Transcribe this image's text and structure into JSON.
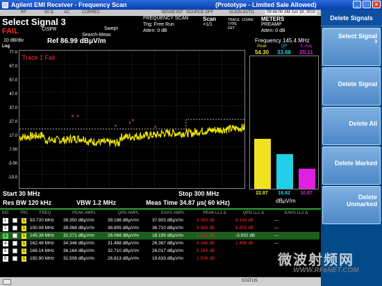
{
  "window": {
    "title": "Agilent EMI Receiver - Frequency Scan",
    "prototype": "(Prototype - Limited Sale Allowed)"
  },
  "status_row": {
    "items": [
      "RF",
      "50 Ω",
      "AC",
      "CORREC",
      "SENSE:INT",
      "SOURCE OFF",
      "ALIGN AUTO"
    ],
    "datetime": "09:46:00 AM Jun 18, 2010"
  },
  "header": {
    "measurement": "Select Signal  3",
    "fail": "FAIL",
    "cispr": "CISPR",
    "swept": "Swept",
    "search_meas": "Search-Meas",
    "scan_mode": "FREQUENCY SCAN",
    "trig": "Trig: Free Run",
    "atten_left": "Atten: 0 dB",
    "scan": "Scan",
    "scan_count": ">1/1",
    "trace_labels": [
      "TRACE",
      "TYPE",
      "DET"
    ],
    "trace_values": [
      "1",
      "2",
      "3",
      "4",
      "5",
      "6"
    ],
    "meters": "METERS",
    "preamp": "PREAMP",
    "atten_right": "Atten: 0 dB"
  },
  "graph": {
    "scale": "10 dB/div",
    "ref_level": "Ref 86.99 dBμV/m",
    "log": "Log",
    "trace_fail": "Trace 1 Fail",
    "y_ticks": [
      "77.0",
      "67.0",
      "57.0",
      "47.0",
      "37.0",
      "27.0",
      "17.0",
      "7.00",
      "-3.00",
      "-13.0"
    ],
    "start": "Start 30 MHz",
    "stop": "Stop 300 MHz",
    "res_bw": "Res BW 120 kHz",
    "vbw": "VBW 1.2 MHz",
    "meas_time": "Meas Time 34.87 μs( 60 kHz)"
  },
  "meters": {
    "frequency": "Frequency  145.4 MHz",
    "captions": [
      "Peak",
      "QP",
      "E-Avg"
    ],
    "values_top": [
      "54.30",
      "33.66",
      "20.11"
    ],
    "values_bottom": [
      "22.87",
      "18.82",
      "10.87"
    ],
    "unit": "dBμV/m",
    "levels_dbuv": [
      27.0,
      18.82,
      10.87
    ],
    "colors": [
      "#f0e020",
      "#20d0e8",
      "#e020e0"
    ]
  },
  "table": {
    "columns": [
      "SIG",
      "",
      "TRC",
      "FREQ",
      "PEAK AMPL",
      "QPD AMPL",
      "EAVG AMPL",
      "PEAK LL1 Δ",
      "QPD LL1 Δ",
      "EAVG LL2 Δ"
    ],
    "rows": [
      {
        "sig": "1",
        "trc": "1",
        "freq": "93.720 MHz",
        "peak": "39.350 dBμV/m",
        "qpd": "39.196 dBμV/m",
        "eavg": "37.903 dBμV/m",
        "pll": "9.350 dB",
        "qll": "9.196 dB",
        "ell": "---",
        "pll_red": true,
        "qll_red": true
      },
      {
        "sig": "2",
        "trc": "1",
        "freq": "100.08 MHz",
        "peak": "39.368 dBμV/m",
        "qpd": "38.805 dBμV/m",
        "eavg": "36.710 dBμV/m",
        "pll": "9.368 dB",
        "qll": "8.805 dB",
        "ell": "---",
        "pll_red": true,
        "qll_red": true
      },
      {
        "sig": "3",
        "trc": "1",
        "freq": "145.38 MHz",
        "peak": "32.271 dBμV/m",
        "qpd": "26.068 dBμV/m",
        "eavg": "18.199 dBμV/m",
        "pll": "2.271 dB",
        "qll": "-3.932 dB",
        "ell": "---",
        "pll_red": true,
        "qll_red": false,
        "selected": true
      },
      {
        "sig": "4",
        "trc": "1",
        "freq": "162.48 MHz",
        "peak": "34.346 dBμV/m",
        "qpd": "31.488 dBμV/m",
        "eavg": "26.367 dBμV/m",
        "pll": "4.346 dB",
        "qll": "1.488 dB",
        "ell": "---",
        "pll_red": true,
        "qll_red": true
      },
      {
        "sig": "5",
        "trc": "1",
        "freq": "166.14 MHz",
        "peak": "36.164 dBμV/m",
        "qpd": "32.710 dBμV/m",
        "eavg": "26.017 dBμV/m",
        "pll": "6.164 dB",
        "qll": "",
        "ell": "",
        "pll_red": true,
        "qll_red": true
      },
      {
        "sig": "6",
        "trc": "1",
        "freq": "192.90 MHz",
        "peak": "31.508 dBμV/m",
        "qpd": "26.813 dBμV/m",
        "eavg": "19.633 dBμV/m",
        "pll": "1.508 dB",
        "qll": "",
        "ell": "",
        "pll_red": true,
        "qll_red": false
      }
    ]
  },
  "statusbar": {
    "status": "STATUS"
  },
  "softkeys": {
    "title": "Delete Signals",
    "keys": [
      {
        "label": "Select Signal",
        "sub": "3"
      },
      {
        "label": "Delete Signal",
        "sub": ""
      },
      {
        "label": "Delete All",
        "sub": ""
      },
      {
        "label": "Delete Marked",
        "sub": ""
      },
      {
        "label": "Delete",
        "sub": "Unmarked"
      }
    ]
  },
  "watermark": {
    "cn": "微波射频网",
    "url": "WWW.RFeNET.COM"
  }
}
